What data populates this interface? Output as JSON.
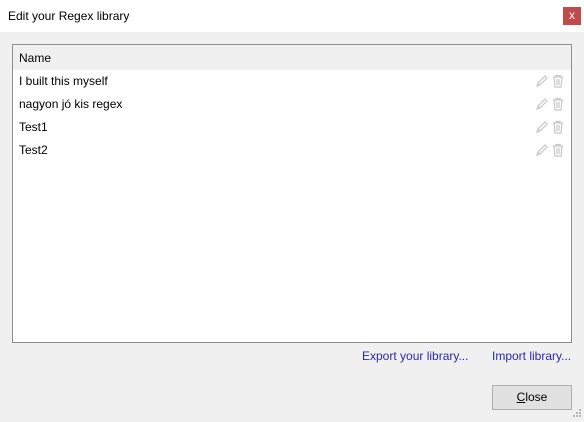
{
  "window": {
    "title": "Edit your Regex library",
    "close_glyph": "x"
  },
  "list": {
    "column_header": "Name",
    "items": [
      {
        "name": "I built this myself"
      },
      {
        "name": "nagyon jó kis regex"
      },
      {
        "name": "Test1"
      },
      {
        "name": "Test2"
      }
    ],
    "row_icons": [
      "pencil-icon",
      "trash-icon"
    ]
  },
  "links": {
    "export_label": "Export your library...",
    "import_label": "Import library..."
  },
  "buttons": {
    "close_access_key": "C",
    "close_rest": "lose"
  },
  "colors": {
    "title_close_bg": "#c14b4b",
    "link": "#2a2aa8",
    "icon_gray": "#c8c8c8"
  }
}
